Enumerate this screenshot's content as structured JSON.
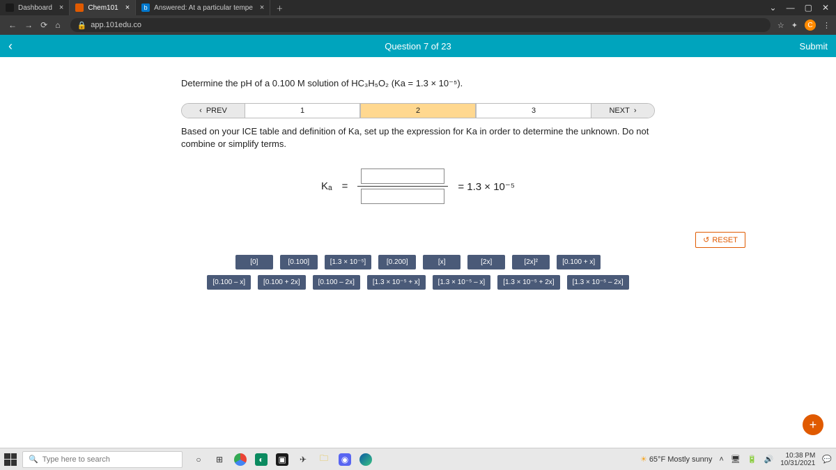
{
  "browser": {
    "tabs": [
      {
        "label": "Dashboard",
        "favicon_bg": "#1a1a1a"
      },
      {
        "label": "Chem101",
        "favicon_bg": "#e05a00"
      },
      {
        "label": "Answered: At a particular tempe",
        "favicon_bg": "#0077cc"
      }
    ],
    "url": "app.101edu.co",
    "ext_letter": "C"
  },
  "header": {
    "question": "Question 7 of 23",
    "submit": "Submit"
  },
  "prompt_html": "Determine the pH of a 0.100 M solution of HC₃H₅O₂ (Ka = 1.3 × 10⁻⁵).",
  "steps": {
    "prev": "PREV",
    "next": "NEXT",
    "labels": [
      "1",
      "2",
      "3"
    ]
  },
  "instruction": "Based on your ICE table and definition of Ka, set up the expression for Ka in order to determine the unknown. Do not combine or simplify terms.",
  "ka": {
    "lhs": "Kₐ",
    "eq": "=",
    "rhs_eq": "=  1.3 × 10⁻⁵"
  },
  "reset": "RESET",
  "tiles": {
    "row1": [
      "[0]",
      "[0.100]",
      "[1.3 × 10⁻⁵]",
      "[0.200]",
      "[x]",
      "[2x]",
      "[2x]²",
      "[0.100 + x]"
    ],
    "row2": [
      "[0.100 – x]",
      "[0.100 + 2x]",
      "[0.100 – 2x]",
      "[1.3 × 10⁻⁵ + x]",
      "[1.3 × 10⁻⁵ – x]",
      "[1.3 × 10⁻⁵ + 2x]",
      "[1.3 × 10⁻⁵ – 2x]"
    ]
  },
  "taskbar": {
    "search_placeholder": "Type here to search",
    "weather": "65°F Mostly sunny",
    "time": "10:38 PM",
    "date": "10/31/2021"
  }
}
